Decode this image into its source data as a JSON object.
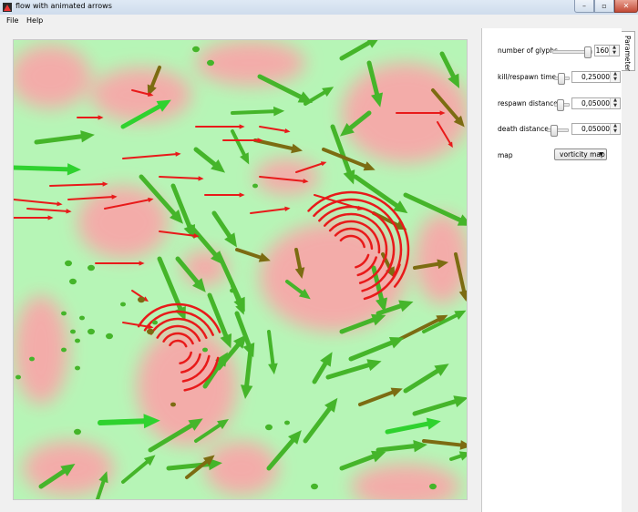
{
  "window": {
    "title": "flow with animated arrows",
    "controls": {
      "minimize": "–",
      "maximize": "▫",
      "close": "✕"
    }
  },
  "menu": {
    "file": "File",
    "help": "Help"
  },
  "panel": {
    "tab_label": "Parameters",
    "number_of_glyphs": {
      "label": "number of glyphs",
      "value": "160"
    },
    "kill_respawn_time": {
      "label": "kill/respawn time",
      "value": "0,25000"
    },
    "respawn_distance": {
      "label": "respawn distance",
      "value": "0,05000"
    },
    "death_distance": {
      "label": "death distance",
      "value": "0,05000"
    },
    "map": {
      "label": "map",
      "selected": "vorticity map"
    }
  },
  "colors": {
    "background_green": "#b6f5b6",
    "background_pink": "#f7a9a9",
    "glyph_bright_green": "#2fd22f",
    "glyph_green": "#45b52a",
    "glyph_olive": "#7c6c12",
    "glyph_red": "#e81a1a"
  },
  "icons": {
    "app": "app-icon",
    "spin_up": "arrow-up-icon",
    "spin_down": "arrow-down-icon",
    "combo": "chevron-down-icon"
  }
}
